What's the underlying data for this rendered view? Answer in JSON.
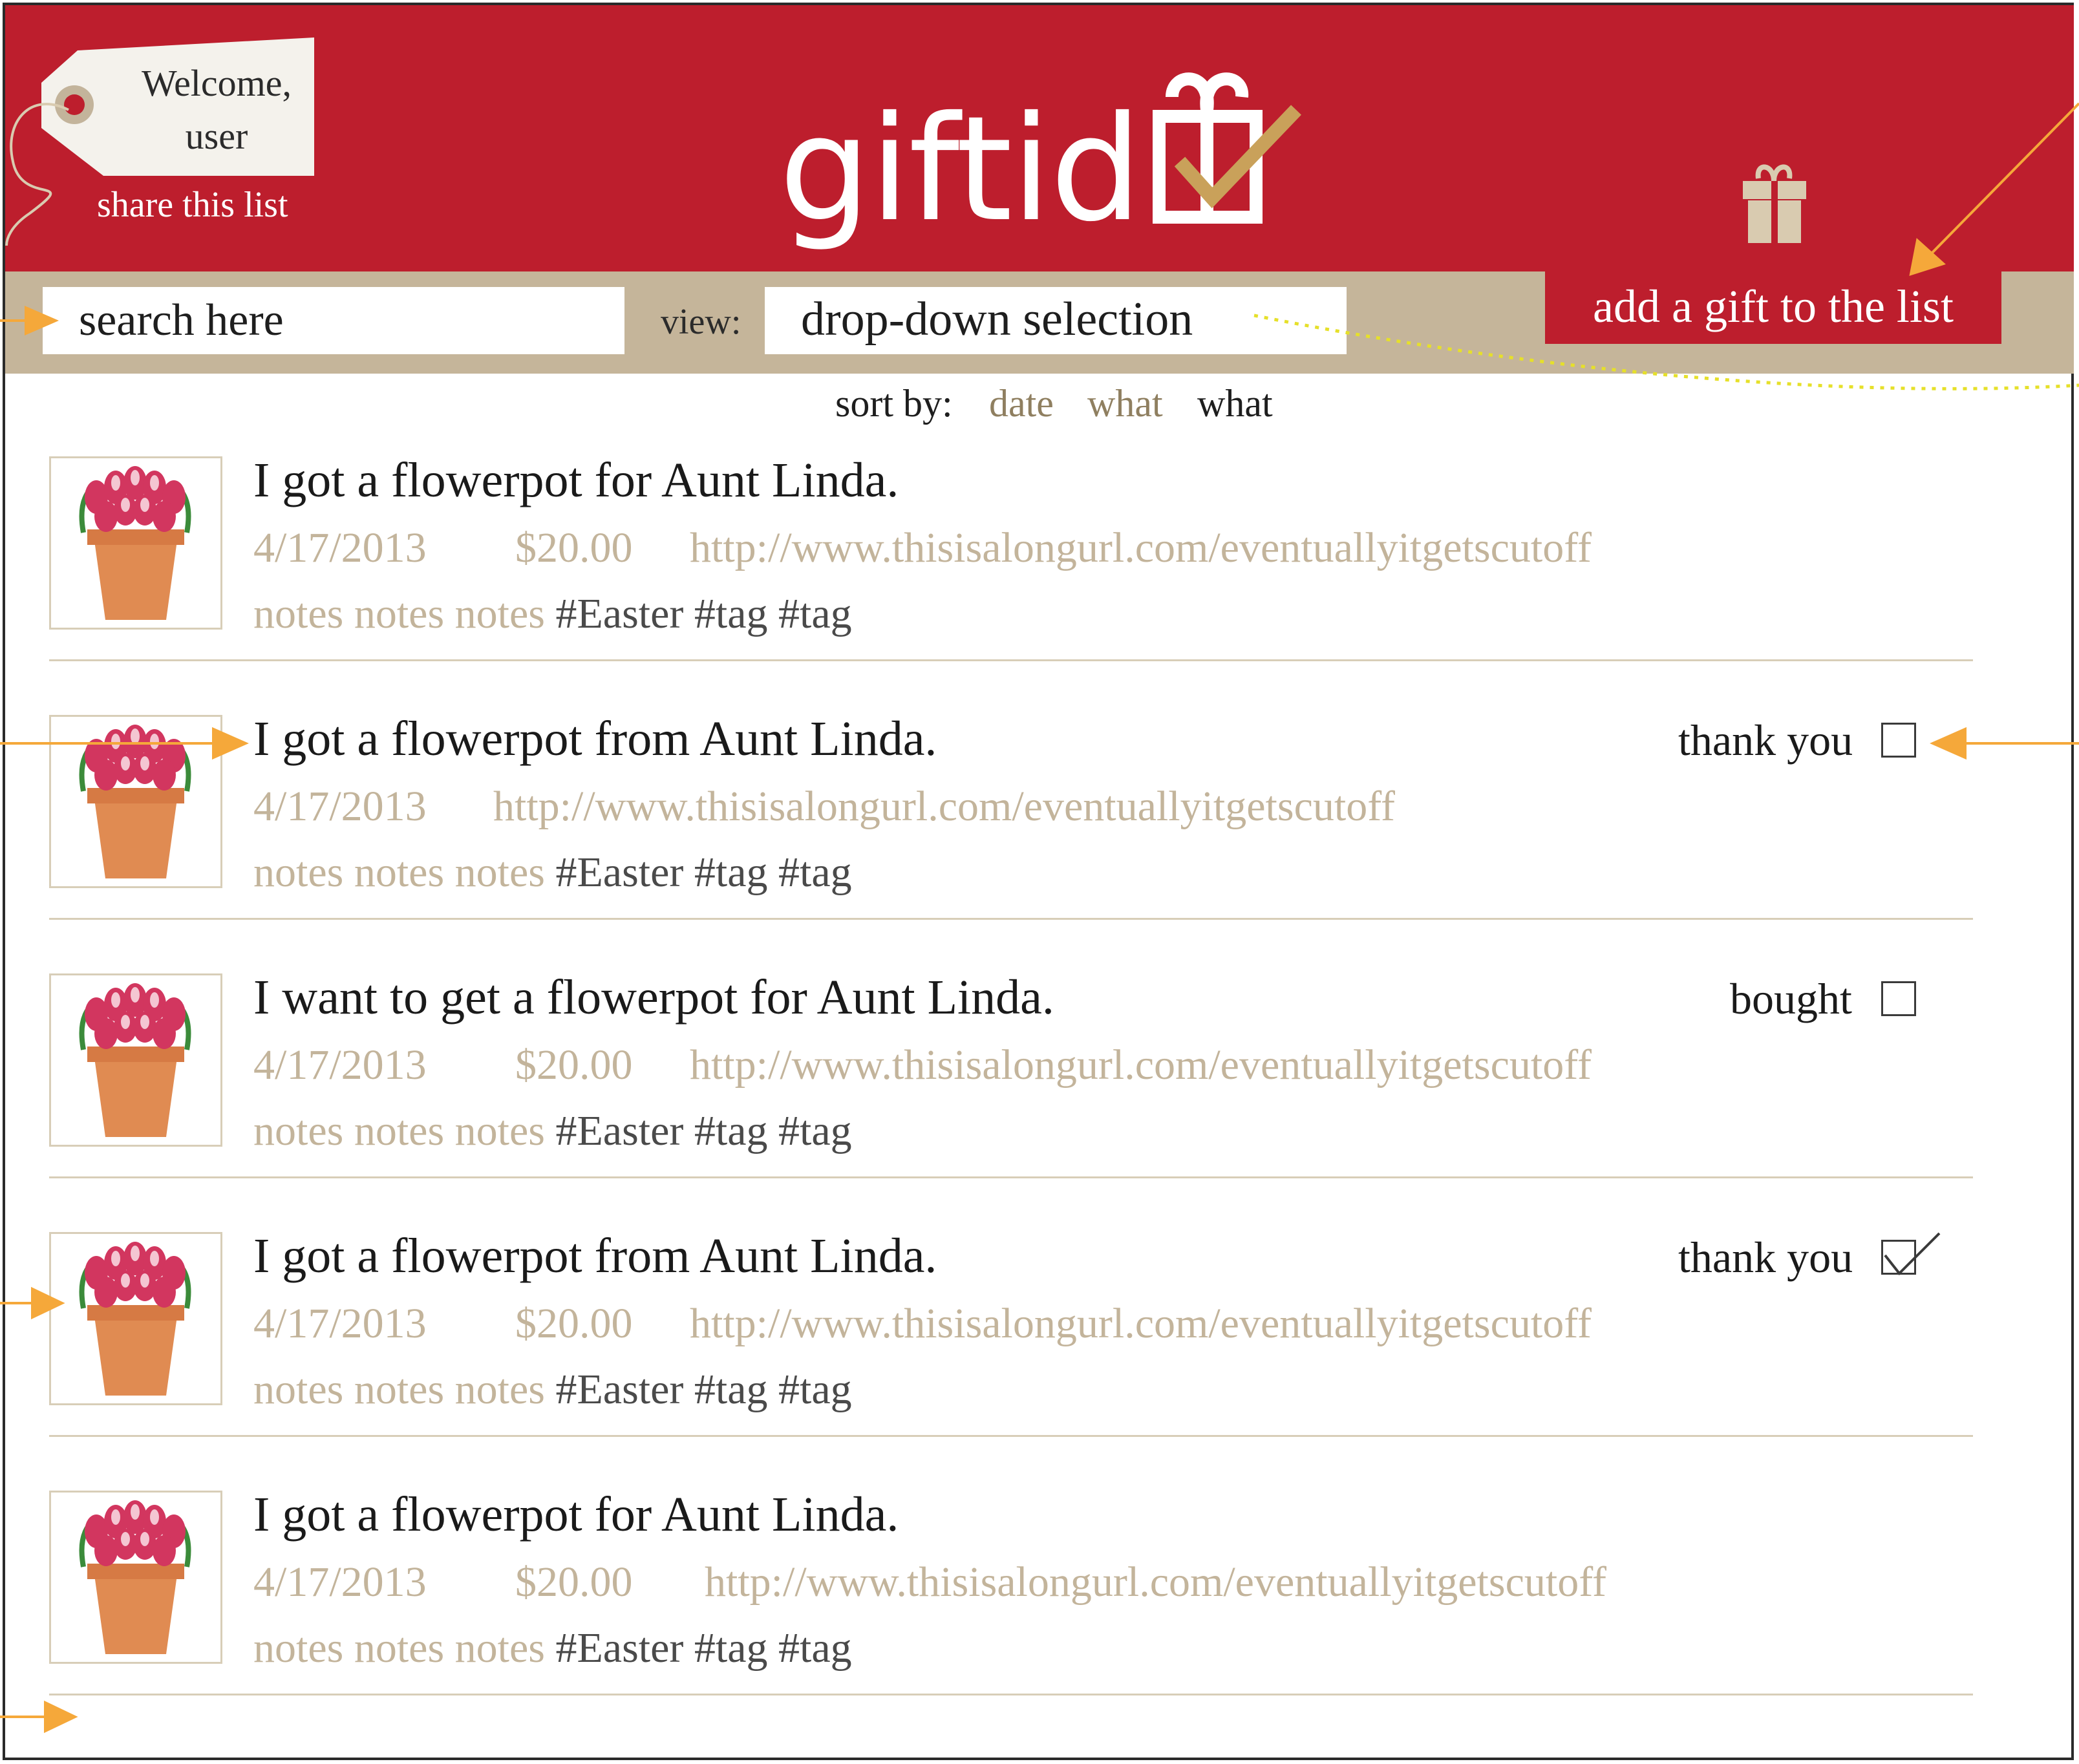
{
  "app": {
    "logo_text": "giftid",
    "welcome_line1": "Welcome,",
    "welcome_line2": "user",
    "share_label": "share this list"
  },
  "toolbar": {
    "search_placeholder": "search here",
    "view_label": "view:",
    "view_value": "drop-down selection",
    "add_button_label": "add a gift to the list"
  },
  "sort": {
    "label": "sort by:",
    "options": [
      "date",
      "what",
      "what"
    ]
  },
  "colors": {
    "brand_red": "#bd1e2d",
    "toolbar_tan": "#c5b59a",
    "meta_tan": "#c3b49b",
    "annotation_orange": "#f5a83a"
  },
  "gifts": [
    {
      "title": "I got a flowerpot for Aunt Linda.",
      "date": "4/17/2013",
      "price": "$20.00",
      "url": "http://www.thisisalongurl.com/eventuallyitgetscutoff",
      "notes": "notes notes notes",
      "tags": "#Easter #tag #tag",
      "status_label": "",
      "checked": false
    },
    {
      "title": "I got a flowerpot from Aunt Linda.",
      "date": "4/17/2013",
      "price": "",
      "url": "http://www.thisisalongurl.com/eventuallyitgetscutoff",
      "notes": "notes notes notes",
      "tags": "#Easter #tag #tag",
      "status_label": "thank you",
      "checked": false
    },
    {
      "title": "I want to get a flowerpot for Aunt Linda.",
      "date": "4/17/2013",
      "price": "$20.00",
      "url": "http://www.thisisalongurl.com/eventuallyitgetscutoff",
      "notes": "notes notes notes",
      "tags": "#Easter #tag #tag",
      "status_label": "bought",
      "checked": false
    },
    {
      "title": "I got a flowerpot from Aunt Linda.",
      "date": "4/17/2013",
      "price": "$20.00",
      "url": "http://www.thisisalongurl.com/eventuallyitgetscutoff",
      "notes": "notes notes notes",
      "tags": "#Easter #tag #tag",
      "status_label": "thank you",
      "checked": true
    },
    {
      "title": "I got a flowerpot for Aunt Linda.",
      "date": "4/17/2013",
      "price": "$20.00",
      "url": "http://www.thisisalongurl.com/eventuallyitgetscutoff",
      "notes": "notes notes notes",
      "tags": "#Easter #tag #tag",
      "status_label": "",
      "checked": false
    }
  ]
}
